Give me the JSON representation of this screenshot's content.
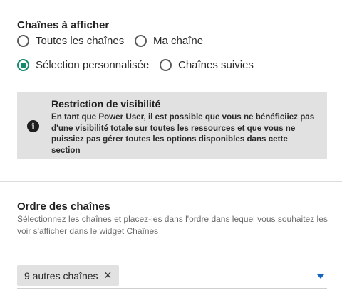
{
  "display_section": {
    "title": "Chaînes à afficher",
    "options": [
      {
        "label": "Toutes les chaînes",
        "checked": false
      },
      {
        "label": "Ma chaîne",
        "checked": false
      },
      {
        "label": "Sélection personnalisée",
        "checked": true
      },
      {
        "label": "Chaînes suivies",
        "checked": false
      }
    ],
    "accent_color": "#138a6e"
  },
  "notice": {
    "icon": "info-icon",
    "title": "Restriction de visibilité",
    "body": "En tant que Power User, il est possible que vous ne bénéficiiez pas d'une visibilité totale sur toutes les ressources et que vous ne puissiez pas gérer toutes les options disponibles dans cette section"
  },
  "order_section": {
    "title": "Ordre des chaînes",
    "description": "Sélectionnez les chaînes et placez-les dans l'ordre dans lequel vous souhaitez les voir s'afficher dans le widget Chaînes",
    "chip_label": "9 autres chaînes",
    "chip_close": "✕",
    "dropdown_icon": "caret-down-icon",
    "dropdown_color": "#1565c0"
  }
}
